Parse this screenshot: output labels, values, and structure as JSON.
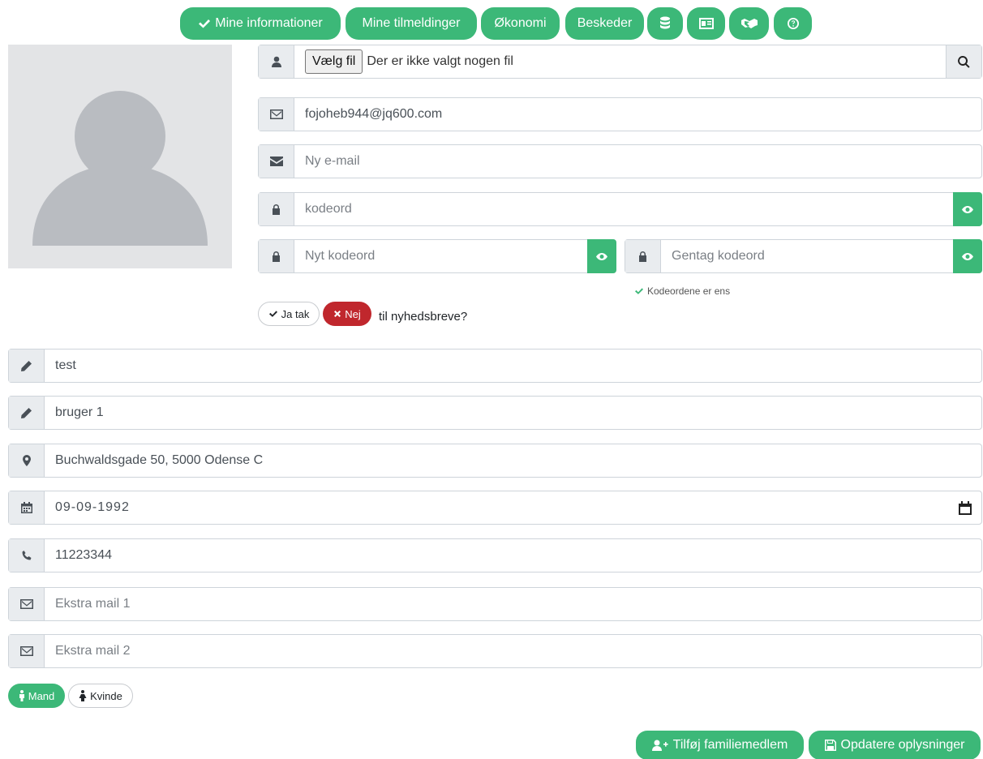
{
  "nav": {
    "mine_informationer": "Mine informationer",
    "mine_tilmeldinger": "Mine tilmeldinger",
    "okonomi": "Økonomi",
    "beskeder": "Beskeder"
  },
  "profile": {
    "file_button": "Vælg fil",
    "file_status": "Der er ikke valgt nogen fil",
    "email": "fojoheb944@jq600.com",
    "new_email_placeholder": "Ny e-mail",
    "password_placeholder": "kodeord",
    "new_password_placeholder": "Nyt kodeord",
    "repeat_password_placeholder": "Gentag kodeord",
    "password_match": "Kodeordene er ens"
  },
  "newsletter": {
    "yes_label": "Ja tak",
    "no_label": "Nej",
    "question": "til nyhedsbreve?",
    "selected": "Nej"
  },
  "details": {
    "first_name": "test",
    "last_name": "bruger 1",
    "address": "Buchwaldsgade 50, 5000 Odense C",
    "birthdate": "09-09-1992",
    "phone": "11223344",
    "extra_mail_1_placeholder": "Ekstra mail 1",
    "extra_mail_2_placeholder": "Ekstra mail 2"
  },
  "gender": {
    "male_label": "Mand",
    "female_label": "Kvinde",
    "selected": "Mand"
  },
  "actions": {
    "add_family_member": "Tilføj familiemedlem",
    "update_info": "Opdatere oplysninger"
  },
  "colors": {
    "accent_green": "#3cb878",
    "danger_red": "#c0272d"
  }
}
